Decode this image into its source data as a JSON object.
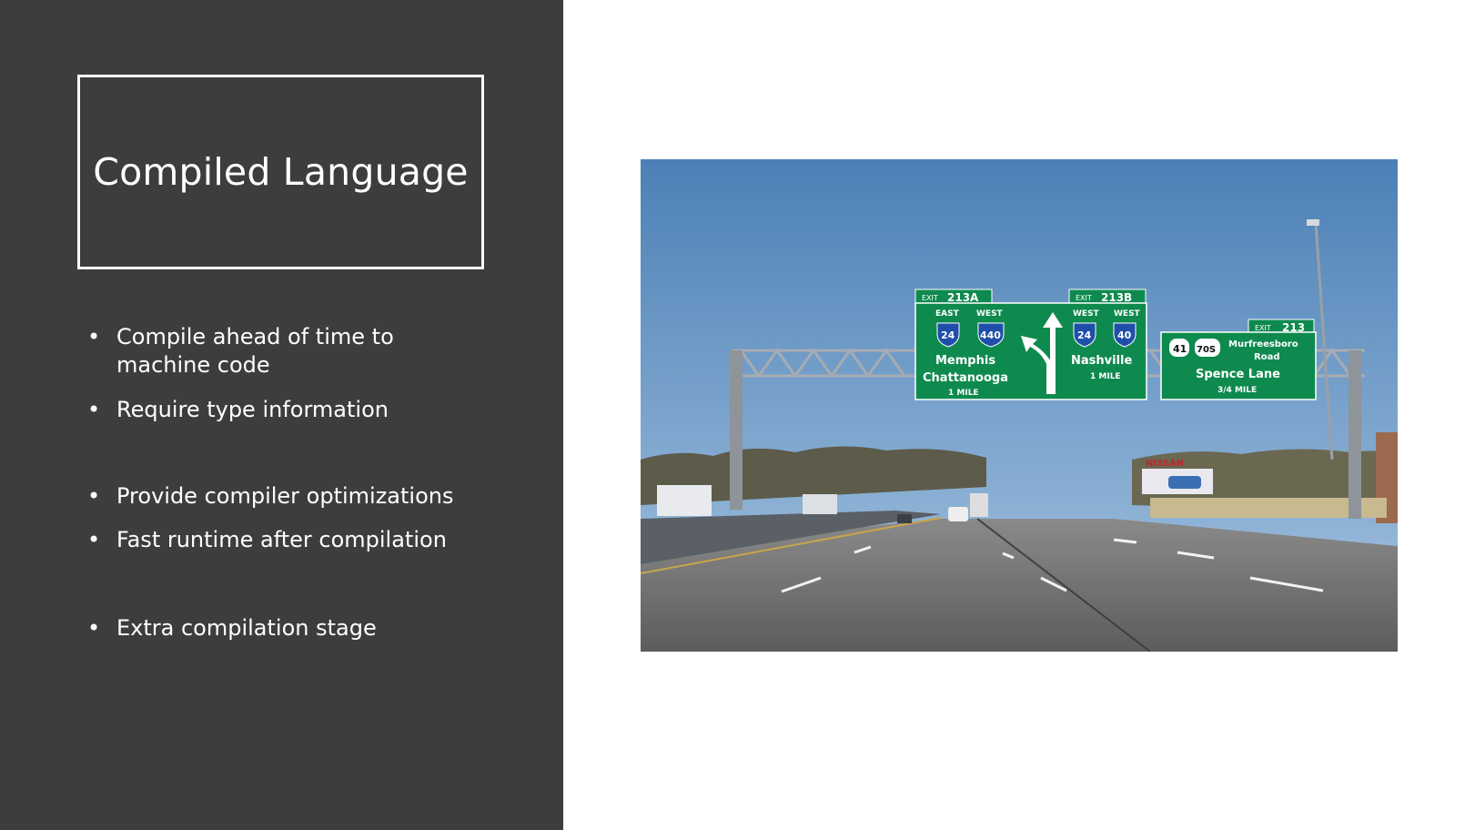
{
  "slide": {
    "title": "Compiled Language",
    "bullets": [
      "Compile ahead of time to machine code",
      "Require type information",
      "Provide compiler optimizations",
      "Fast runtime after compilation",
      "Extra compilation stage"
    ]
  },
  "photo": {
    "signs": {
      "exit_213a": "213A",
      "exit_213b": "213B",
      "exit_213": "213",
      "exit_word": "EXIT",
      "east": "EAST",
      "west": "WEST",
      "i24": "24",
      "i440": "440",
      "i40": "40",
      "us41": "41",
      "us70s": "70S",
      "memphis": "Memphis",
      "chattanooga": "Chattanooga",
      "nashville": "Nashville",
      "one_mile_a": "1 MILE",
      "one_mile_b": "1 MILE",
      "murfreesboro": "Murfreesboro",
      "road": "Road",
      "spence": "Spence Lane",
      "three_quarter": "3/4 MILE",
      "billboard": "NISSAN"
    },
    "colors": {
      "sky_top": "#4a7fb5",
      "sky_bottom": "#a9c6e0",
      "sign_green": "#0f8a4f",
      "road": "#6b6b6b"
    }
  }
}
